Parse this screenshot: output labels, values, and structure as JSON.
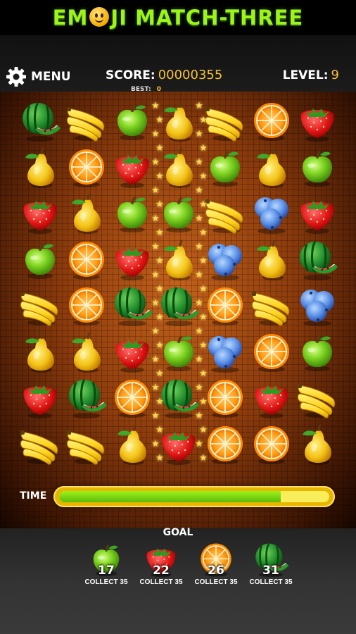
{
  "title": {
    "before": "EM",
    "after": "JI MATCH-THREE",
    "face_icon": "smiley-face-icon"
  },
  "menu": {
    "label": "MENU",
    "icon": "gear-icon"
  },
  "score": {
    "label": "SCORE:",
    "value": "00000355"
  },
  "best": {
    "label": "BEST:",
    "value": "0"
  },
  "level": {
    "label": "LEVEL:",
    "value": "9"
  },
  "board": {
    "rows": [
      [
        "watermelon",
        "banana",
        "apple",
        "pear",
        "banana",
        "orange",
        "strawberry"
      ],
      [
        "pear",
        "orange",
        "strawberry",
        "pear",
        "apple",
        "pear",
        "apple"
      ],
      [
        "strawberry",
        "pear",
        "apple",
        "apple",
        "banana",
        "blueberry",
        "strawberry"
      ],
      [
        "apple",
        "orange",
        "strawberry",
        "pear",
        "blueberry",
        "pear",
        "watermelon"
      ],
      [
        "banana",
        "orange",
        "watermelon",
        "watermelon",
        "orange",
        "banana",
        "blueberry"
      ],
      [
        "pear",
        "pear",
        "strawberry",
        "apple",
        "blueberry",
        "orange",
        "apple"
      ],
      [
        "strawberry",
        "watermelon",
        "orange",
        "watermelon",
        "orange",
        "strawberry",
        "banana"
      ],
      [
        "banana",
        "banana",
        "pear",
        "strawberry",
        "orange",
        "orange",
        "pear"
      ]
    ],
    "highlighted_column": 3,
    "sparkle_icon": "star-sparkle-icon"
  },
  "time": {
    "label": "TIME",
    "remaining_fraction": 0.82
  },
  "goal": {
    "label": "GOAL",
    "items": [
      {
        "fruit": "apple",
        "count": "17",
        "text": "COLLECT 35"
      },
      {
        "fruit": "strawberry",
        "count": "22",
        "text": "COLLECT 35"
      },
      {
        "fruit": "orange",
        "count": "26",
        "text": "COLLECT 35"
      },
      {
        "fruit": "watermelon",
        "count": "31",
        "text": "COLLECT 35"
      }
    ]
  },
  "colors": {
    "accent_green": "#9cf51a",
    "score_gold": "#f6c23a",
    "board_orange": "#c4621b"
  }
}
